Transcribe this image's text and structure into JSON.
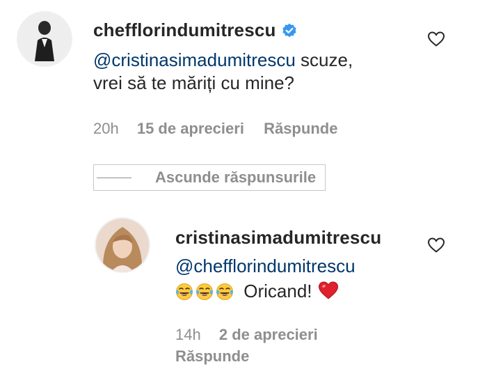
{
  "comment": {
    "username": "chefflorindumitrescu",
    "verified": true,
    "mention": "@cristinasimadumitrescu",
    "text_line1_rest": " scuze,",
    "text_line2": "vrei să te măriți cu mine?",
    "time": "20h",
    "likes": "15 de aprecieri",
    "reply_label": "Răspunde",
    "like_icon": "heart-outline-icon"
  },
  "replies_toggle": {
    "label": "Ascunde răspunsurile"
  },
  "reply": {
    "username": "cristinasimadumitrescu",
    "mention": "@chefflorindumitrescu",
    "emoji": [
      "tears-of-joy-emoji",
      "tears-of-joy-emoji",
      "tears-of-joy-emoji"
    ],
    "text": "Oricand!",
    "trailing_emoji": "red-heart-emoji",
    "time": "14h",
    "likes": "2 de aprecieri",
    "reply_label": "Răspunde",
    "like_icon": "heart-outline-icon"
  },
  "colors": {
    "mention": "#00376b",
    "verified_badge": "#3897f0",
    "meta_text": "#8e8e8e",
    "heart": "#e0202e"
  }
}
